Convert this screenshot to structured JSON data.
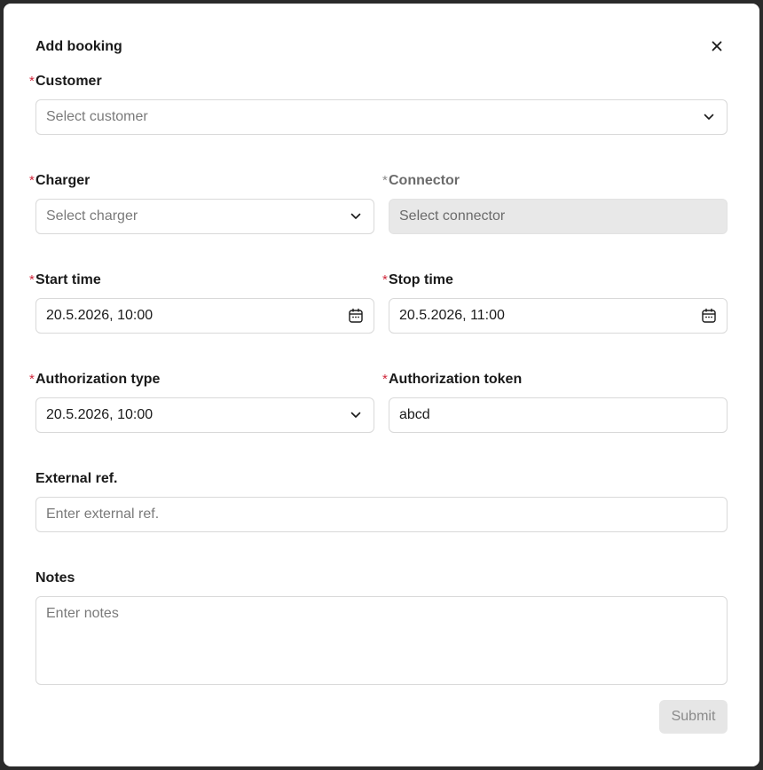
{
  "dialog": {
    "title": "Add booking",
    "submit_label": "Submit"
  },
  "form": {
    "required_mark": "*",
    "customer": {
      "label": "Customer",
      "placeholder": "Select customer"
    },
    "charger": {
      "label": "Charger",
      "placeholder": "Select charger"
    },
    "connector": {
      "label": "Connector",
      "placeholder": "Select connector"
    },
    "start_time": {
      "label": "Start time",
      "value": "20.5.2026, 10:00"
    },
    "stop_time": {
      "label": "Stop time",
      "value": "20.5.2026, 11:00"
    },
    "authorization_type": {
      "label": "Authorization type",
      "value": "20.5.2026, 10:00"
    },
    "authorization_token": {
      "label": "Authorization token",
      "value": "abcd"
    },
    "external_ref": {
      "label": "External ref.",
      "placeholder": "Enter external ref."
    },
    "notes": {
      "label": "Notes",
      "placeholder": "Enter notes"
    }
  },
  "icons": {
    "close": "close-icon",
    "dropdown": "chevron-down-icon",
    "calendar": "calendar-icon"
  }
}
